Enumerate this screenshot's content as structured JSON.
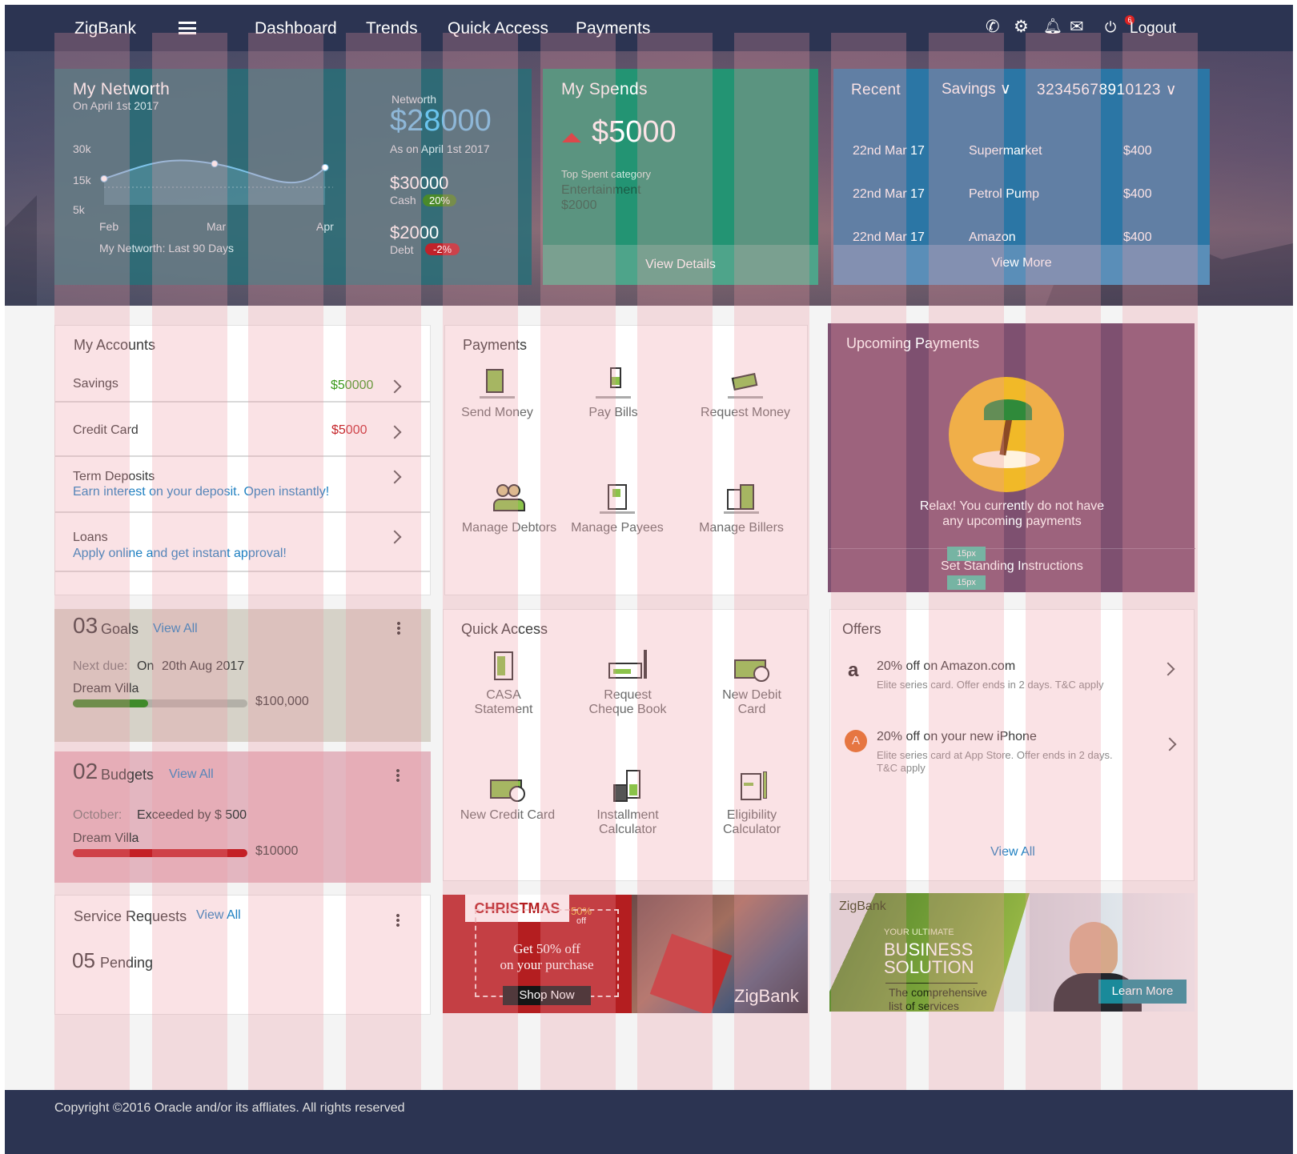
{
  "nav": {
    "brand": "ZigBank",
    "links": [
      "Dashboard",
      "Trends",
      "Quick Access",
      "Payments"
    ],
    "logout": "Logout",
    "mail_count": "6"
  },
  "networth": {
    "title": "My Networth",
    "date": "On April 1st 2017",
    "label": "Networth",
    "value": "$28000",
    "as_on": "As on April 1st 2017",
    "cash_value": "$30000",
    "cash_label": "Cash",
    "cash_pct": "20%",
    "debt_value": "$2000",
    "debt_label": "Debt",
    "debt_pct": "-2%",
    "caption": "My Networth: Last 90 Days",
    "chart_data": {
      "type": "area",
      "x": [
        "Feb",
        "Mar",
        "Apr"
      ],
      "yticks": [
        "30k",
        "15k",
        "5k"
      ],
      "values": [
        14,
        22,
        20
      ]
    }
  },
  "spends": {
    "title": "My Spends",
    "value": "$5000",
    "top_label": "Top Spent category",
    "category": "Entertainment",
    "amount": "$2000",
    "action": "View Details"
  },
  "recent": {
    "title": "Recent",
    "filter": "Savings",
    "account": "32345678910123",
    "rows": [
      {
        "date": "22nd Mar 17",
        "desc": "Supermarket",
        "amt": "$400"
      },
      {
        "date": "22nd Mar 17",
        "desc": "Petrol Pump",
        "amt": "$400"
      },
      {
        "date": "22nd Mar 17",
        "desc": "Amazon",
        "amt": "$400"
      }
    ],
    "action": "View More"
  },
  "accounts": {
    "title": "My Accounts",
    "savings": "Savings",
    "savings_amt": "$50000",
    "credit": "Credit Card",
    "credit_amt": "$5000",
    "term": "Term Deposits",
    "term_sub": "Earn interest on your deposit. Open instantly!",
    "loans": "Loans",
    "loans_sub": "Apply online and get instant approval!"
  },
  "payments": {
    "title": "Payments",
    "items": [
      "Send Money",
      "Pay Bills",
      "Request Money",
      "Manage Debtors",
      "Manage Payees",
      "Manage Billers"
    ]
  },
  "upcoming": {
    "title": "Upcoming Payments",
    "msg1": "Relax! You currently do not have",
    "msg2": "any upcoming payments",
    "action": "Set Standing Instructions",
    "spacing": "15px"
  },
  "goals": {
    "count": "03",
    "label": "Goals",
    "view": "View All",
    "next": "Next due:",
    "on": "On",
    "date": "20th Aug 2017",
    "name": "Dream Villa",
    "amount": "$100,000",
    "progress": 0.43
  },
  "budgets": {
    "count": "02",
    "label": "Budgets",
    "view": "View All",
    "month": "October:",
    "status": "Exceeded by $ 500",
    "name": "Dream Villa",
    "amount": "$10000",
    "progress": 1.0
  },
  "service": {
    "title": "Service Requests",
    "view": "View All",
    "count": "05",
    "label": "Pending"
  },
  "quick": {
    "title": "Quick Access",
    "items": [
      [
        "CASA",
        "Statement"
      ],
      [
        "Request",
        "Cheque Book"
      ],
      [
        "New  Debit",
        "Card"
      ],
      [
        "New Credit Card",
        ""
      ],
      [
        "Installment",
        "Calculator"
      ],
      [
        "Eligibility",
        "Calculator"
      ]
    ]
  },
  "offers": {
    "title": "Offers",
    "o1_title": "20% off on Amazon.com",
    "o1_sub": "Elite series card. Offer ends in 2 days. T&C apply",
    "o2_title": "20% off on your new iPhone",
    "o2_sub1": "Elite series card at App Store. Offer ends in 2 days.",
    "o2_sub2": "T&C apply",
    "view": "View All"
  },
  "xmas": {
    "title": "CHRISTMAS",
    "pct": "50%",
    "off": "off",
    "l1": "Get 50% off",
    "l2": "on your purchase",
    "cta": "Shop Now",
    "brand": "ZigBank"
  },
  "biz": {
    "brand": "ZigBank",
    "l1": "YOUR ULTIMATE",
    "l2": "BUSINESS",
    "l3": "SOLUTION",
    "l4": "The comprehensive",
    "l5": "list of services",
    "cta": "Learn More"
  },
  "footer": "Copyright ©2016 Oracle and/or its affliates. All rights reserved"
}
